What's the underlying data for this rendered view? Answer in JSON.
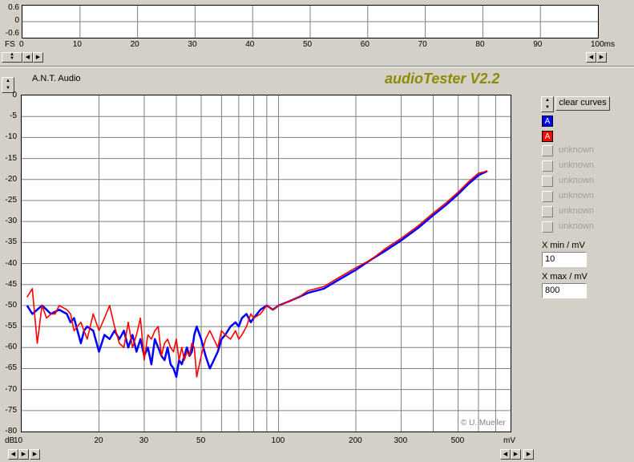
{
  "scope": {
    "y_ticks": [
      "0.6",
      "0",
      "-0.6"
    ],
    "x_axis_unit_left": "FS",
    "x_ticks": [
      "0",
      "10",
      "20",
      "30",
      "40",
      "50",
      "60",
      "70",
      "80",
      "90",
      "100ms"
    ]
  },
  "brand": "A.N.T. Audio",
  "app_title": "audioTester V2.2",
  "controls": {
    "clear_curves": "clear curves",
    "channels": [
      {
        "label": "A",
        "color": "#0000ff"
      },
      {
        "label": "A",
        "color": "#ff0000"
      }
    ],
    "unknown_items": [
      "unknown",
      "unknown",
      "unknown",
      "unknown",
      "unknown",
      "unknown"
    ],
    "xmin_label": "X min / mV",
    "xmin_value": "10",
    "xmax_label": "X max / mV",
    "xmax_value": "800"
  },
  "copyright": "© U. Mueller",
  "chart_data": {
    "type": "line",
    "xscale": "log",
    "xlim": [
      10,
      800
    ],
    "ylim": [
      -80,
      0
    ],
    "ylabel": "dB",
    "xlabel": "mV",
    "y_ticks": [
      "0",
      "-5",
      "-10",
      "-15",
      "-20",
      "-25",
      "-30",
      "-35",
      "-40",
      "-45",
      "-50",
      "-55",
      "-60",
      "-65",
      "-70",
      "-75",
      "-80"
    ],
    "x_tick_labels": [
      {
        "v": 10,
        "t": "10"
      },
      {
        "v": 20,
        "t": "20"
      },
      {
        "v": 30,
        "t": "30"
      },
      {
        "v": 50,
        "t": "50"
      },
      {
        "v": 100,
        "t": "100"
      },
      {
        "v": 200,
        "t": "200"
      },
      {
        "v": 300,
        "t": "300"
      },
      {
        "v": 500,
        "t": "500"
      }
    ],
    "grid": true,
    "series": [
      {
        "color": "#0000ff",
        "x": [
          10.5,
          11,
          11.5,
          12,
          12.5,
          13,
          14,
          15,
          15.5,
          16,
          17,
          17.5,
          18,
          19,
          20,
          21,
          22,
          23,
          24,
          25,
          26,
          27,
          28,
          29,
          30,
          31,
          32,
          33,
          34,
          35,
          36,
          37,
          38,
          39,
          40,
          41,
          42,
          43,
          44,
          45,
          46,
          47,
          48,
          50,
          52,
          54,
          56,
          58,
          60,
          62,
          65,
          68,
          70,
          72,
          75,
          78,
          80,
          85,
          90,
          95,
          100,
          110,
          120,
          130,
          150,
          170,
          200,
          230,
          260,
          300,
          350,
          400,
          450,
          500,
          550,
          600,
          650
        ],
        "y": [
          -50,
          -52,
          -51,
          -50,
          -51,
          -52,
          -51,
          -52,
          -54,
          -53,
          -59,
          -56,
          -55,
          -56,
          -61,
          -57,
          -58,
          -56,
          -58,
          -56,
          -60,
          -57,
          -61,
          -58,
          -62,
          -60,
          -64,
          -58,
          -60,
          -62,
          -63,
          -60,
          -64,
          -65,
          -67,
          -63,
          -64,
          -62,
          -60,
          -62,
          -61,
          -57,
          -55,
          -58,
          -62,
          -65,
          -63,
          -61,
          -58,
          -57,
          -55,
          -54,
          -55,
          -53,
          -52,
          -54,
          -53,
          -51,
          -50,
          -51,
          -50,
          -49,
          -48,
          -47,
          -46,
          -44,
          -41.5,
          -39,
          -37,
          -34.5,
          -31.5,
          -28.5,
          -26,
          -23.5,
          -21,
          -19,
          -18
        ]
      },
      {
        "color": "#ff0000",
        "x": [
          10.5,
          11,
          11.5,
          12,
          12.5,
          13,
          13.5,
          14,
          15,
          15.5,
          16,
          17,
          18,
          19,
          20,
          21,
          22,
          23,
          24,
          25,
          26,
          27,
          28,
          29,
          30,
          31,
          32,
          33,
          34,
          35,
          36,
          37,
          38,
          39,
          40,
          41,
          42,
          43,
          44,
          45,
          46,
          47,
          48,
          50,
          52,
          54,
          56,
          58,
          60,
          62,
          65,
          68,
          70,
          72,
          75,
          78,
          80,
          85,
          90,
          95,
          100,
          110,
          120,
          130,
          150,
          170,
          200,
          230,
          260,
          300,
          350,
          400,
          450,
          500,
          550,
          600,
          650
        ],
        "y": [
          -48,
          -46,
          -59,
          -50,
          -53,
          -52,
          -52,
          -50,
          -51,
          -52,
          -56,
          -54,
          -58,
          -52,
          -56,
          -53,
          -50,
          -55,
          -59,
          -60,
          -54,
          -60,
          -57,
          -53,
          -63,
          -57,
          -58,
          -56,
          -55,
          -62,
          -59,
          -58,
          -60,
          -61,
          -58,
          -63,
          -60,
          -63,
          -61,
          -62,
          -59,
          -60,
          -67,
          -62,
          -58,
          -56,
          -58,
          -60,
          -56,
          -57,
          -58,
          -56,
          -58,
          -57,
          -55,
          -52,
          -53,
          -52,
          -50,
          -51,
          -50,
          -49,
          -48,
          -46.5,
          -45.5,
          -43.5,
          -41,
          -39,
          -36.5,
          -34,
          -31,
          -28,
          -25.5,
          -23,
          -20.5,
          -18.5,
          -18
        ]
      }
    ]
  }
}
